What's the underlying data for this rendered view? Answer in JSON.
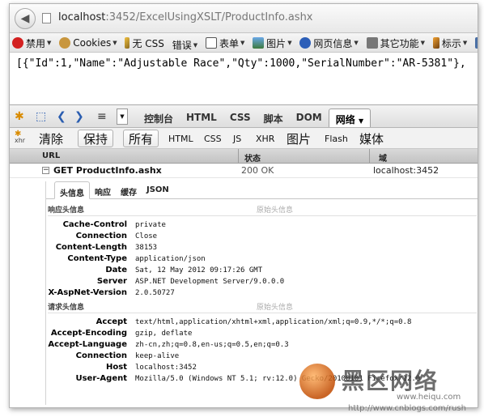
{
  "browser": {
    "url_host": "localhost",
    "url_path": ":3452/ExcelUsingXSLT/ProductInfo.ashx"
  },
  "dev_toolbar": {
    "items": [
      "禁用",
      "Cookies",
      "无 CSS",
      "错误",
      "表单",
      "图片",
      "网页信息",
      "其它功能",
      "标示"
    ]
  },
  "page": {
    "content": "[{\"Id\":1,\"Name\":\"Adjustable Race\",\"Qty\":1000,\"SerialNumber\":\"AR-5381\"},"
  },
  "firebug": {
    "tabs": [
      "控制台",
      "HTML",
      "CSS",
      "脚本",
      "DOM",
      "网络"
    ],
    "active_tab": "网络",
    "net_buttons": [
      "清除",
      "保持",
      "所有",
      "HTML",
      "CSS",
      "JS",
      "XHR",
      "图片",
      "Flash",
      "媒体"
    ],
    "xhr_icon_label": "xhr",
    "columns": {
      "url": "URL",
      "status": "状态",
      "domain": "域"
    },
    "request": {
      "name": "GET ProductInfo.ashx",
      "status": "200 OK",
      "domain": "localhost:3452"
    },
    "detail_tabs": [
      "头信息",
      "响应",
      "缓存",
      "JSON"
    ],
    "response_headers_title": "响应头信息",
    "request_headers_title": "请求头信息",
    "raw_label": "原始头信息",
    "response_headers": [
      {
        "k": "Cache-Control",
        "v": "private"
      },
      {
        "k": "Connection",
        "v": "Close"
      },
      {
        "k": "Content-Length",
        "v": "38153"
      },
      {
        "k": "Content-Type",
        "v": "application/json"
      },
      {
        "k": "Date",
        "v": "Sat, 12 May 2012 09:17:26 GMT"
      },
      {
        "k": "Server",
        "v": "ASP.NET Development Server/9.0.0.0"
      },
      {
        "k": "X-AspNet-Version",
        "v": "2.0.50727"
      }
    ],
    "request_headers": [
      {
        "k": "Accept",
        "v": "text/html,application/xhtml+xml,application/xml;q=0.9,*/*;q=0.8"
      },
      {
        "k": "Accept-Encoding",
        "v": "gzip, deflate"
      },
      {
        "k": "Accept-Language",
        "v": "zh-cn,zh;q=0.8,en-us;q=0.5,en;q=0.3"
      },
      {
        "k": "Connection",
        "v": "keep-alive"
      },
      {
        "k": "Host",
        "v": "localhost:3452"
      },
      {
        "k": "User-Agent",
        "v": "Mozilla/5.0 (Windows NT 5.1; rv:12.0) Gecko/20100101 Firefox/12.0"
      }
    ]
  },
  "watermark": {
    "title": "黑区网络",
    "site": "www.heiqu.com",
    "url": "http://www.cnblogs.com/rush"
  }
}
